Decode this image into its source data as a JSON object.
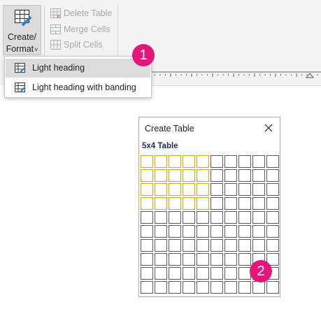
{
  "ribbon": {
    "create_format": {
      "line1": "Create/",
      "line2": "Format",
      "chevron": "˅"
    },
    "commands": [
      {
        "label": "Delete Table",
        "icon": "delete-table-icon"
      },
      {
        "label": "Merge Cells",
        "icon": "merge-cells-icon"
      },
      {
        "label": "Split Cells",
        "icon": "split-cells-icon"
      }
    ]
  },
  "dropdown": {
    "items": [
      {
        "label": "Light heading",
        "icon": "table-style-icon",
        "highlighted": true
      },
      {
        "label": "Light heading with banding",
        "icon": "table-style-icon",
        "highlighted": false
      }
    ]
  },
  "callouts": {
    "one": "1",
    "two": "2"
  },
  "panel": {
    "title": "Create Table",
    "size_label": "5x4 Table",
    "grid": {
      "cols": 10,
      "rows": 10,
      "selected_cols": 5,
      "selected_rows": 4
    }
  },
  "colors": {
    "badge": "#e6157a",
    "selected_cell_border": "#e0a500",
    "cell_border": "#5a5a5a"
  }
}
